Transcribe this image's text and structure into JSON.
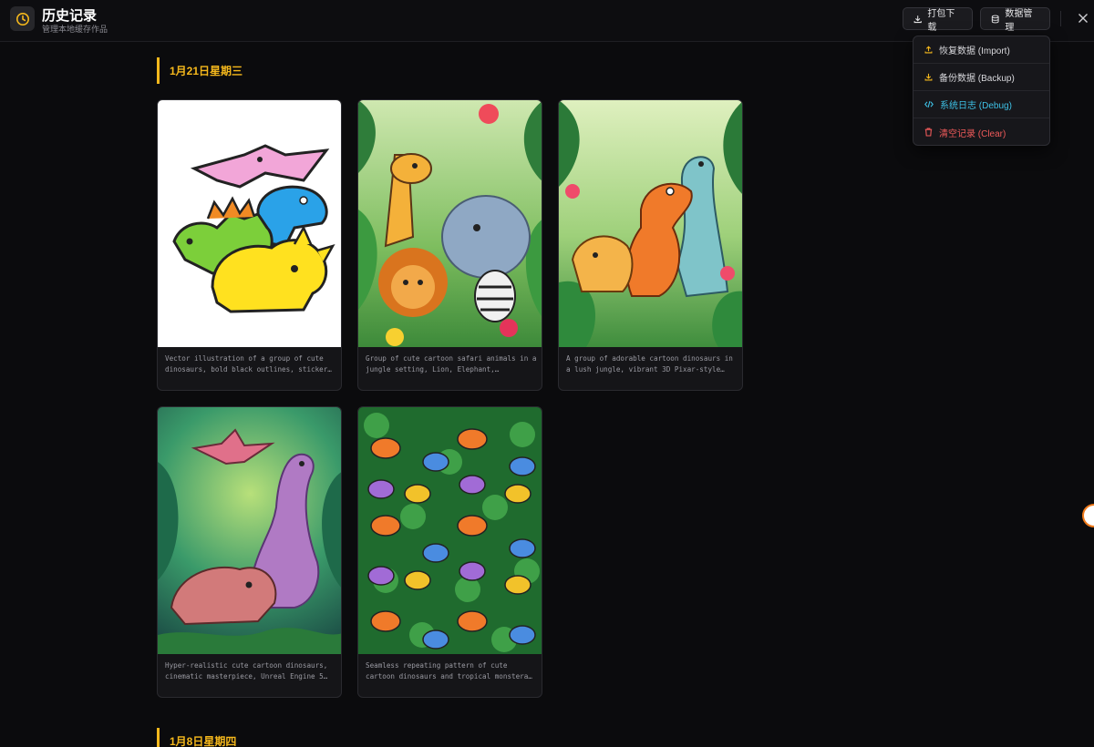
{
  "header": {
    "title": "历史记录",
    "subtitle": "管理本地缓存作品",
    "download_label": "打包下载",
    "data_label": "数据管理"
  },
  "menu": {
    "items": [
      {
        "label": "恢复数据 (Import)",
        "icon": "upload-icon"
      },
      {
        "label": "备份数据 (Backup)",
        "icon": "download-icon"
      },
      {
        "label": "系统日志 (Debug)",
        "icon": "code-icon"
      },
      {
        "label": "清空记录 (Clear)",
        "icon": "trash-icon"
      }
    ]
  },
  "sections": [
    {
      "date": "1月21日星期三",
      "cards": [
        {
          "caption": "Vector illustration of a group of cute dinosaurs, bold black outlines, sticker…"
        },
        {
          "caption": "Group of cute cartoon safari animals in a jungle setting, Lion, Elephant,…"
        },
        {
          "caption": "A group of adorable cartoon dinosaurs in a lush jungle, vibrant 3D Pixar-style…"
        },
        {
          "caption": "Hyper-realistic cute cartoon dinosaurs, cinematic masterpiece, Unreal Engine 5…"
        },
        {
          "caption": "Seamless repeating pattern of cute cartoon dinosaurs and tropical monstera…"
        }
      ]
    },
    {
      "date": "1月8日星期四",
      "cards": []
    }
  ],
  "colors": {
    "accent": "#f5b81c",
    "debug": "#3ec1e6",
    "danger": "#ef5a5a",
    "background": "#0b0b0d"
  }
}
